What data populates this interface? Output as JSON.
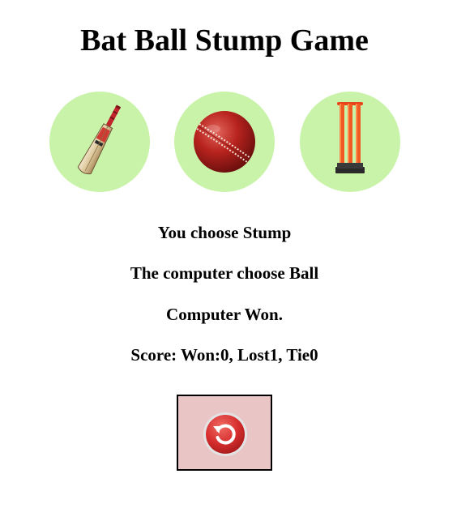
{
  "title": "Bat Ball Stump Game",
  "choices": [
    {
      "name": "Bat",
      "icon": "cricket-bat-icon"
    },
    {
      "name": "Ball",
      "icon": "cricket-ball-icon"
    },
    {
      "name": "Stump",
      "icon": "cricket-stumps-icon"
    }
  ],
  "result": {
    "user_choice": "You choose Stump",
    "computer_choice": "The computer choose Ball",
    "outcome": "Computer Won.",
    "score": "Score: Won:0, Lost1, Tie0"
  },
  "reset_button": {
    "icon": "reset-icon"
  },
  "colors": {
    "choice_bg": "#c8f3a8",
    "reset_bg": "#e9c5c6",
    "reset_icon": "#d62e2e"
  }
}
